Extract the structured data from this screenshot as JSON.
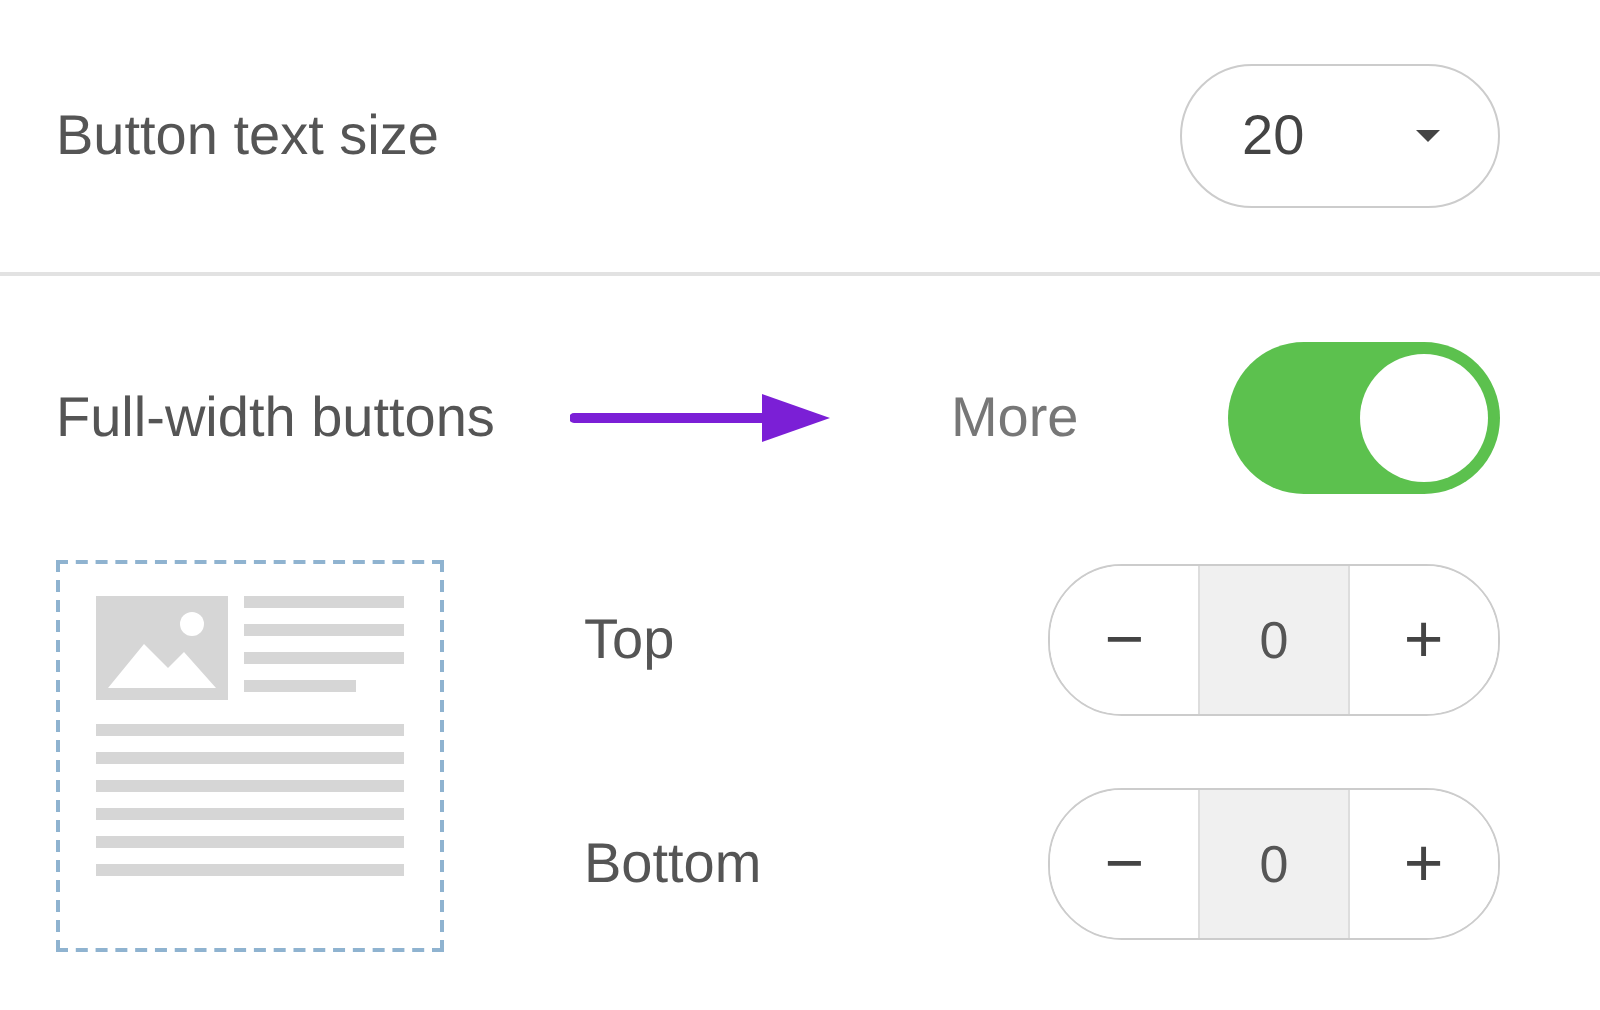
{
  "text_size": {
    "label": "Button text size",
    "value": "20"
  },
  "full_width": {
    "label": "Full-width buttons",
    "hint": "More",
    "on": true
  },
  "padding": [
    {
      "label": "Top",
      "minus": "−",
      "value": "0",
      "plus": "+"
    },
    {
      "label": "Bottom",
      "minus": "−",
      "value": "0",
      "plus": "+"
    }
  ]
}
